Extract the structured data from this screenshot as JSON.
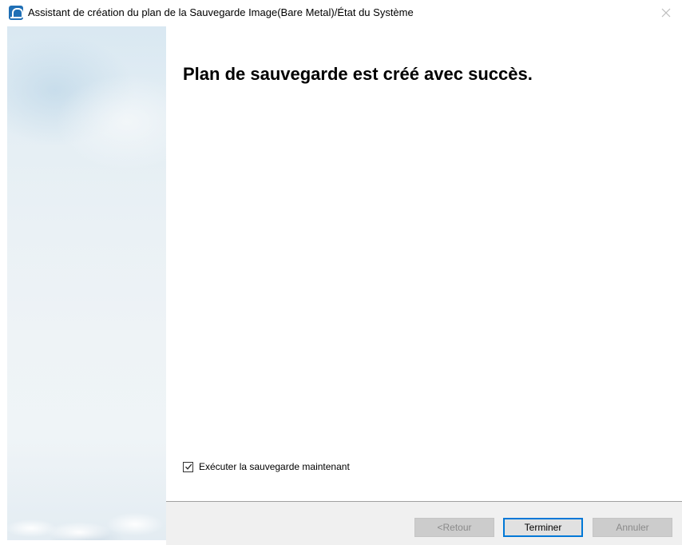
{
  "window": {
    "title": "Assistant de création du plan de la Sauvegarde Image(Bare Metal)/État du Système",
    "icon": "app-logo-icon",
    "close_icon": "close-icon"
  },
  "main": {
    "heading": "Plan de sauvegarde est créé avec succès.",
    "run_now": {
      "label": "Exécuter la sauvegarde maintenant",
      "checked": true
    }
  },
  "footer": {
    "back_label": "<Retour",
    "finish_label": "Terminer",
    "cancel_label": "Annuler"
  },
  "colors": {
    "accent": "#0078d7",
    "footer_bg": "#f0f0f0",
    "disabled_button": "#cccccc"
  }
}
